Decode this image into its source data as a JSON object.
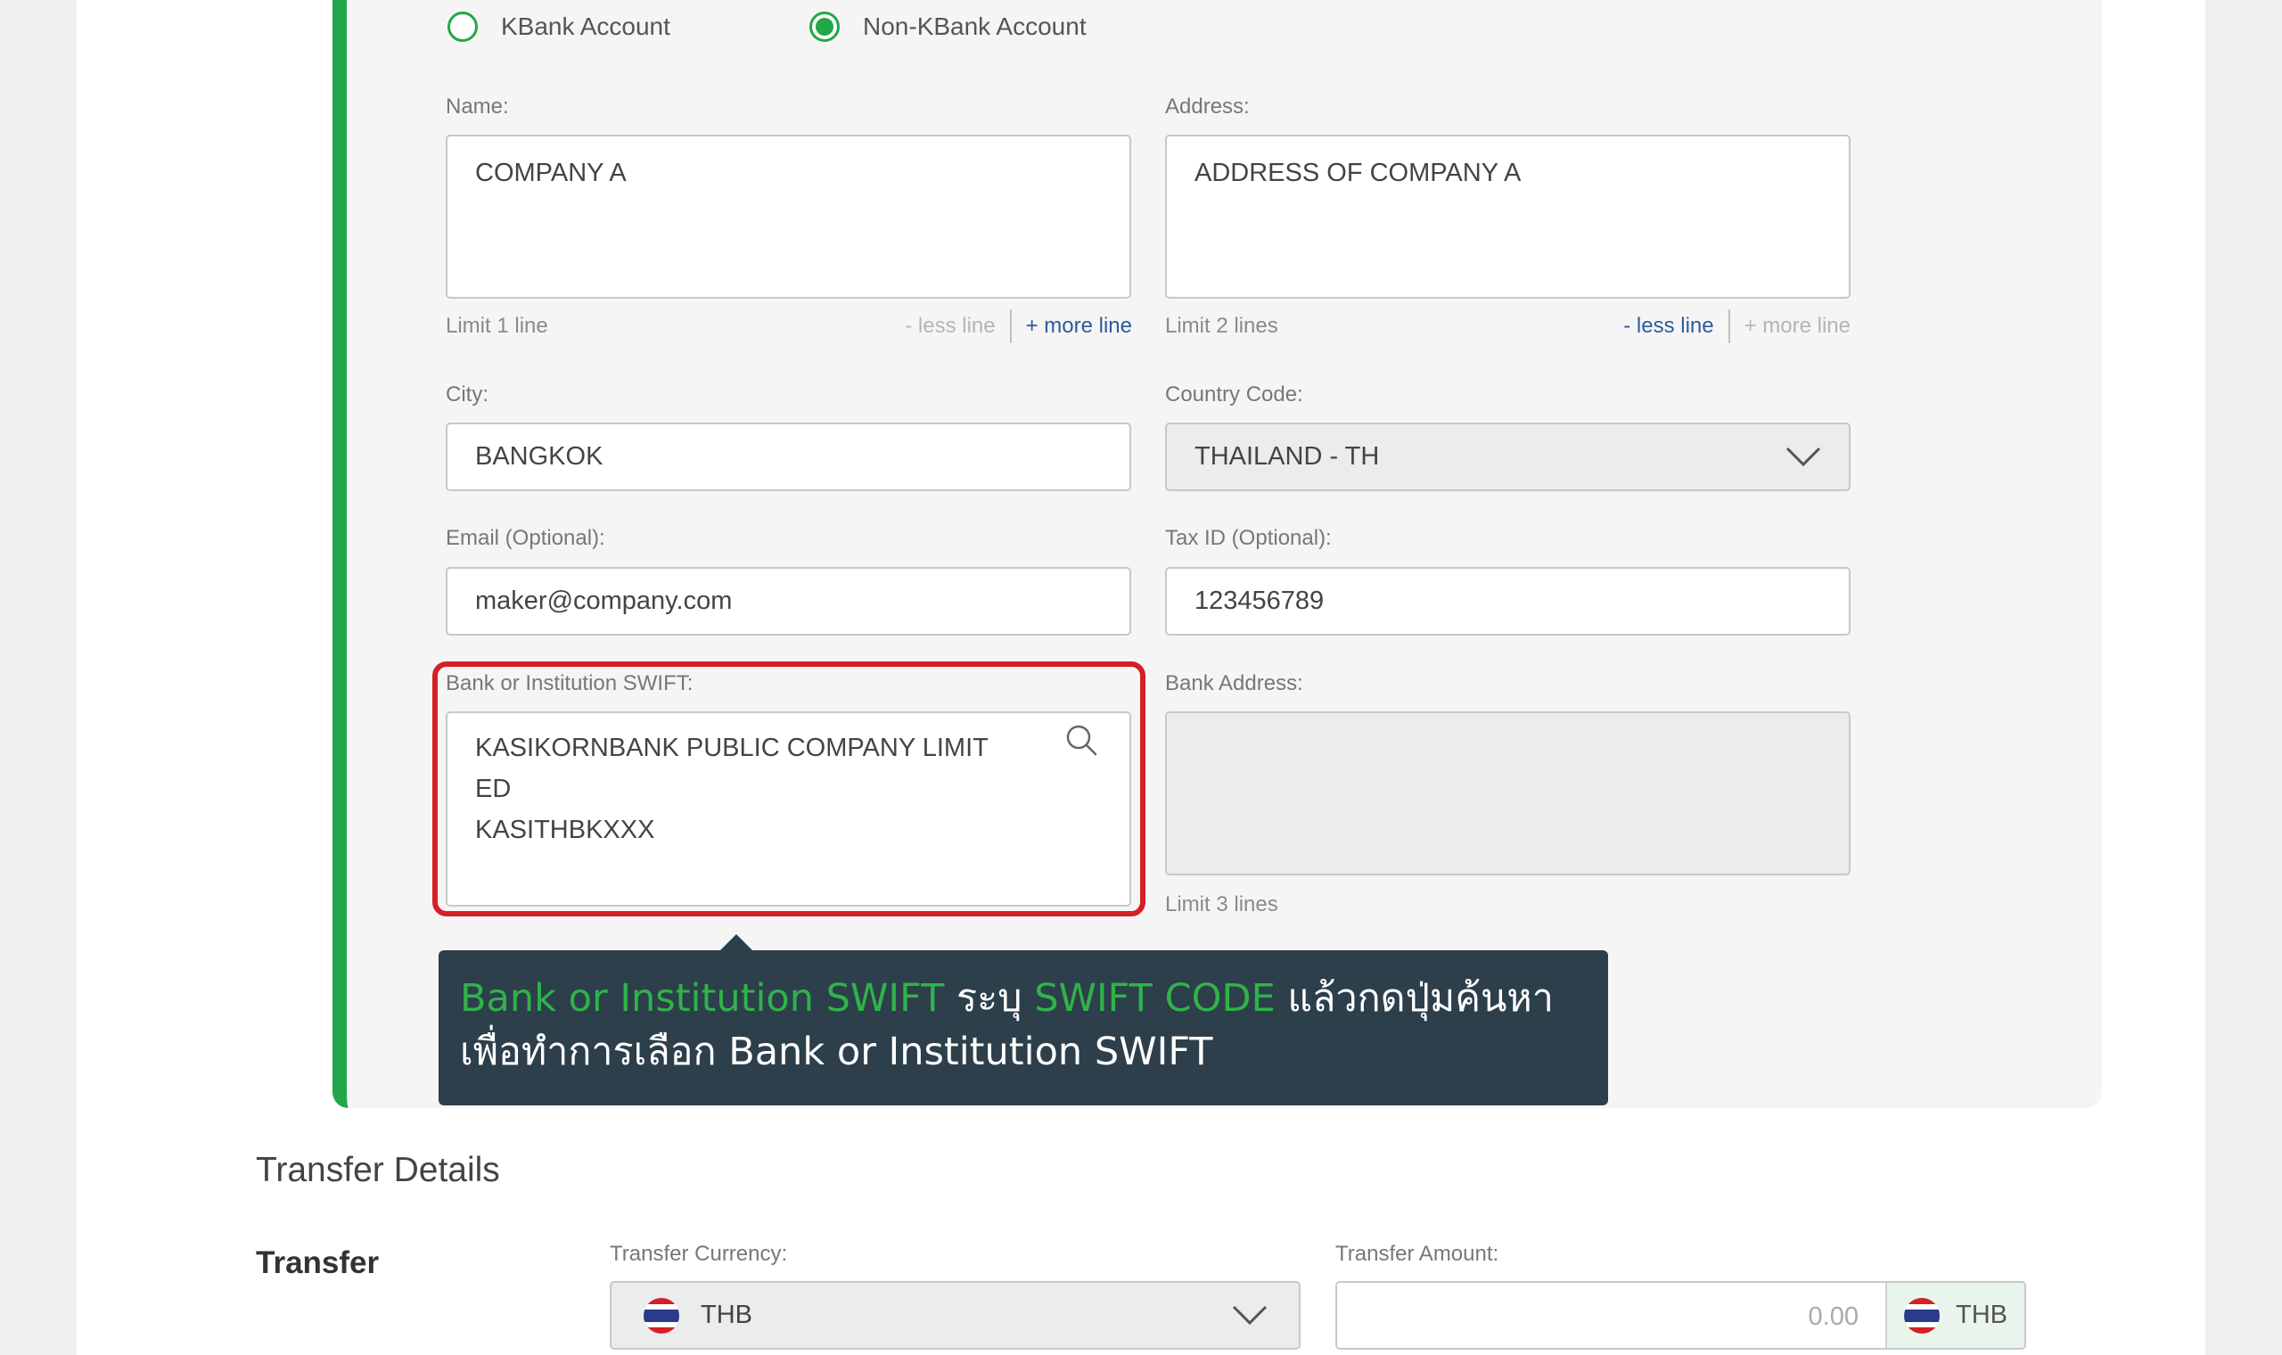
{
  "recipient_type": {
    "kbank_label": "KBank Account",
    "non_kbank_label": "Non-KBank Account",
    "selected": "non_kbank"
  },
  "name": {
    "label": "Name:",
    "value": "COMPANY A",
    "limit": "Limit 1 line",
    "less": "- less line",
    "more": "+ more line"
  },
  "address": {
    "label": "Address:",
    "value": "ADDRESS OF COMPANY A",
    "limit": "Limit 2 lines",
    "less": "- less line",
    "more": "+ more line"
  },
  "city": {
    "label": "City:",
    "value": "BANGKOK"
  },
  "country": {
    "label": "Country Code:",
    "value": "THAILAND - TH"
  },
  "email": {
    "label": "Email (Optional):",
    "value": "maker@company.com"
  },
  "tax": {
    "label": "Tax ID (Optional):",
    "value": "123456789"
  },
  "swift": {
    "label": "Bank or Institution SWIFT:",
    "value": "KASIKORNBANK PUBLIC COMPANY LIMIT\nED\nKASITHBKXXX"
  },
  "bank_address": {
    "label": "Bank Address:",
    "value": "",
    "limit": "Limit 3 lines"
  },
  "tooltip": {
    "part1": "Bank or Institution SWIFT",
    "part2": " ระบุ ",
    "part3": "SWIFT CODE",
    "part4": " แล้วกดปุ่มค้นหา",
    "line2": "เพื่อทำการเลือก Bank or Institution SWIFT"
  },
  "transfer_details": {
    "section_title": "Transfer Details",
    "row_title": "Transfer",
    "currency_label": "Transfer Currency:",
    "currency_value": "THB",
    "amount_label": "Transfer Amount:",
    "amount_placeholder": "0.00",
    "amount_currency": "THB"
  },
  "colors": {
    "accent_green": "#22a748",
    "highlight_red": "#d61f26",
    "tooltip_bg": "#2d3f4a",
    "link_blue": "#2c5c9c"
  },
  "icons": {
    "search": "search-icon",
    "dropdown": "chevron-down-icon",
    "flag": "thailand-flag-icon"
  }
}
